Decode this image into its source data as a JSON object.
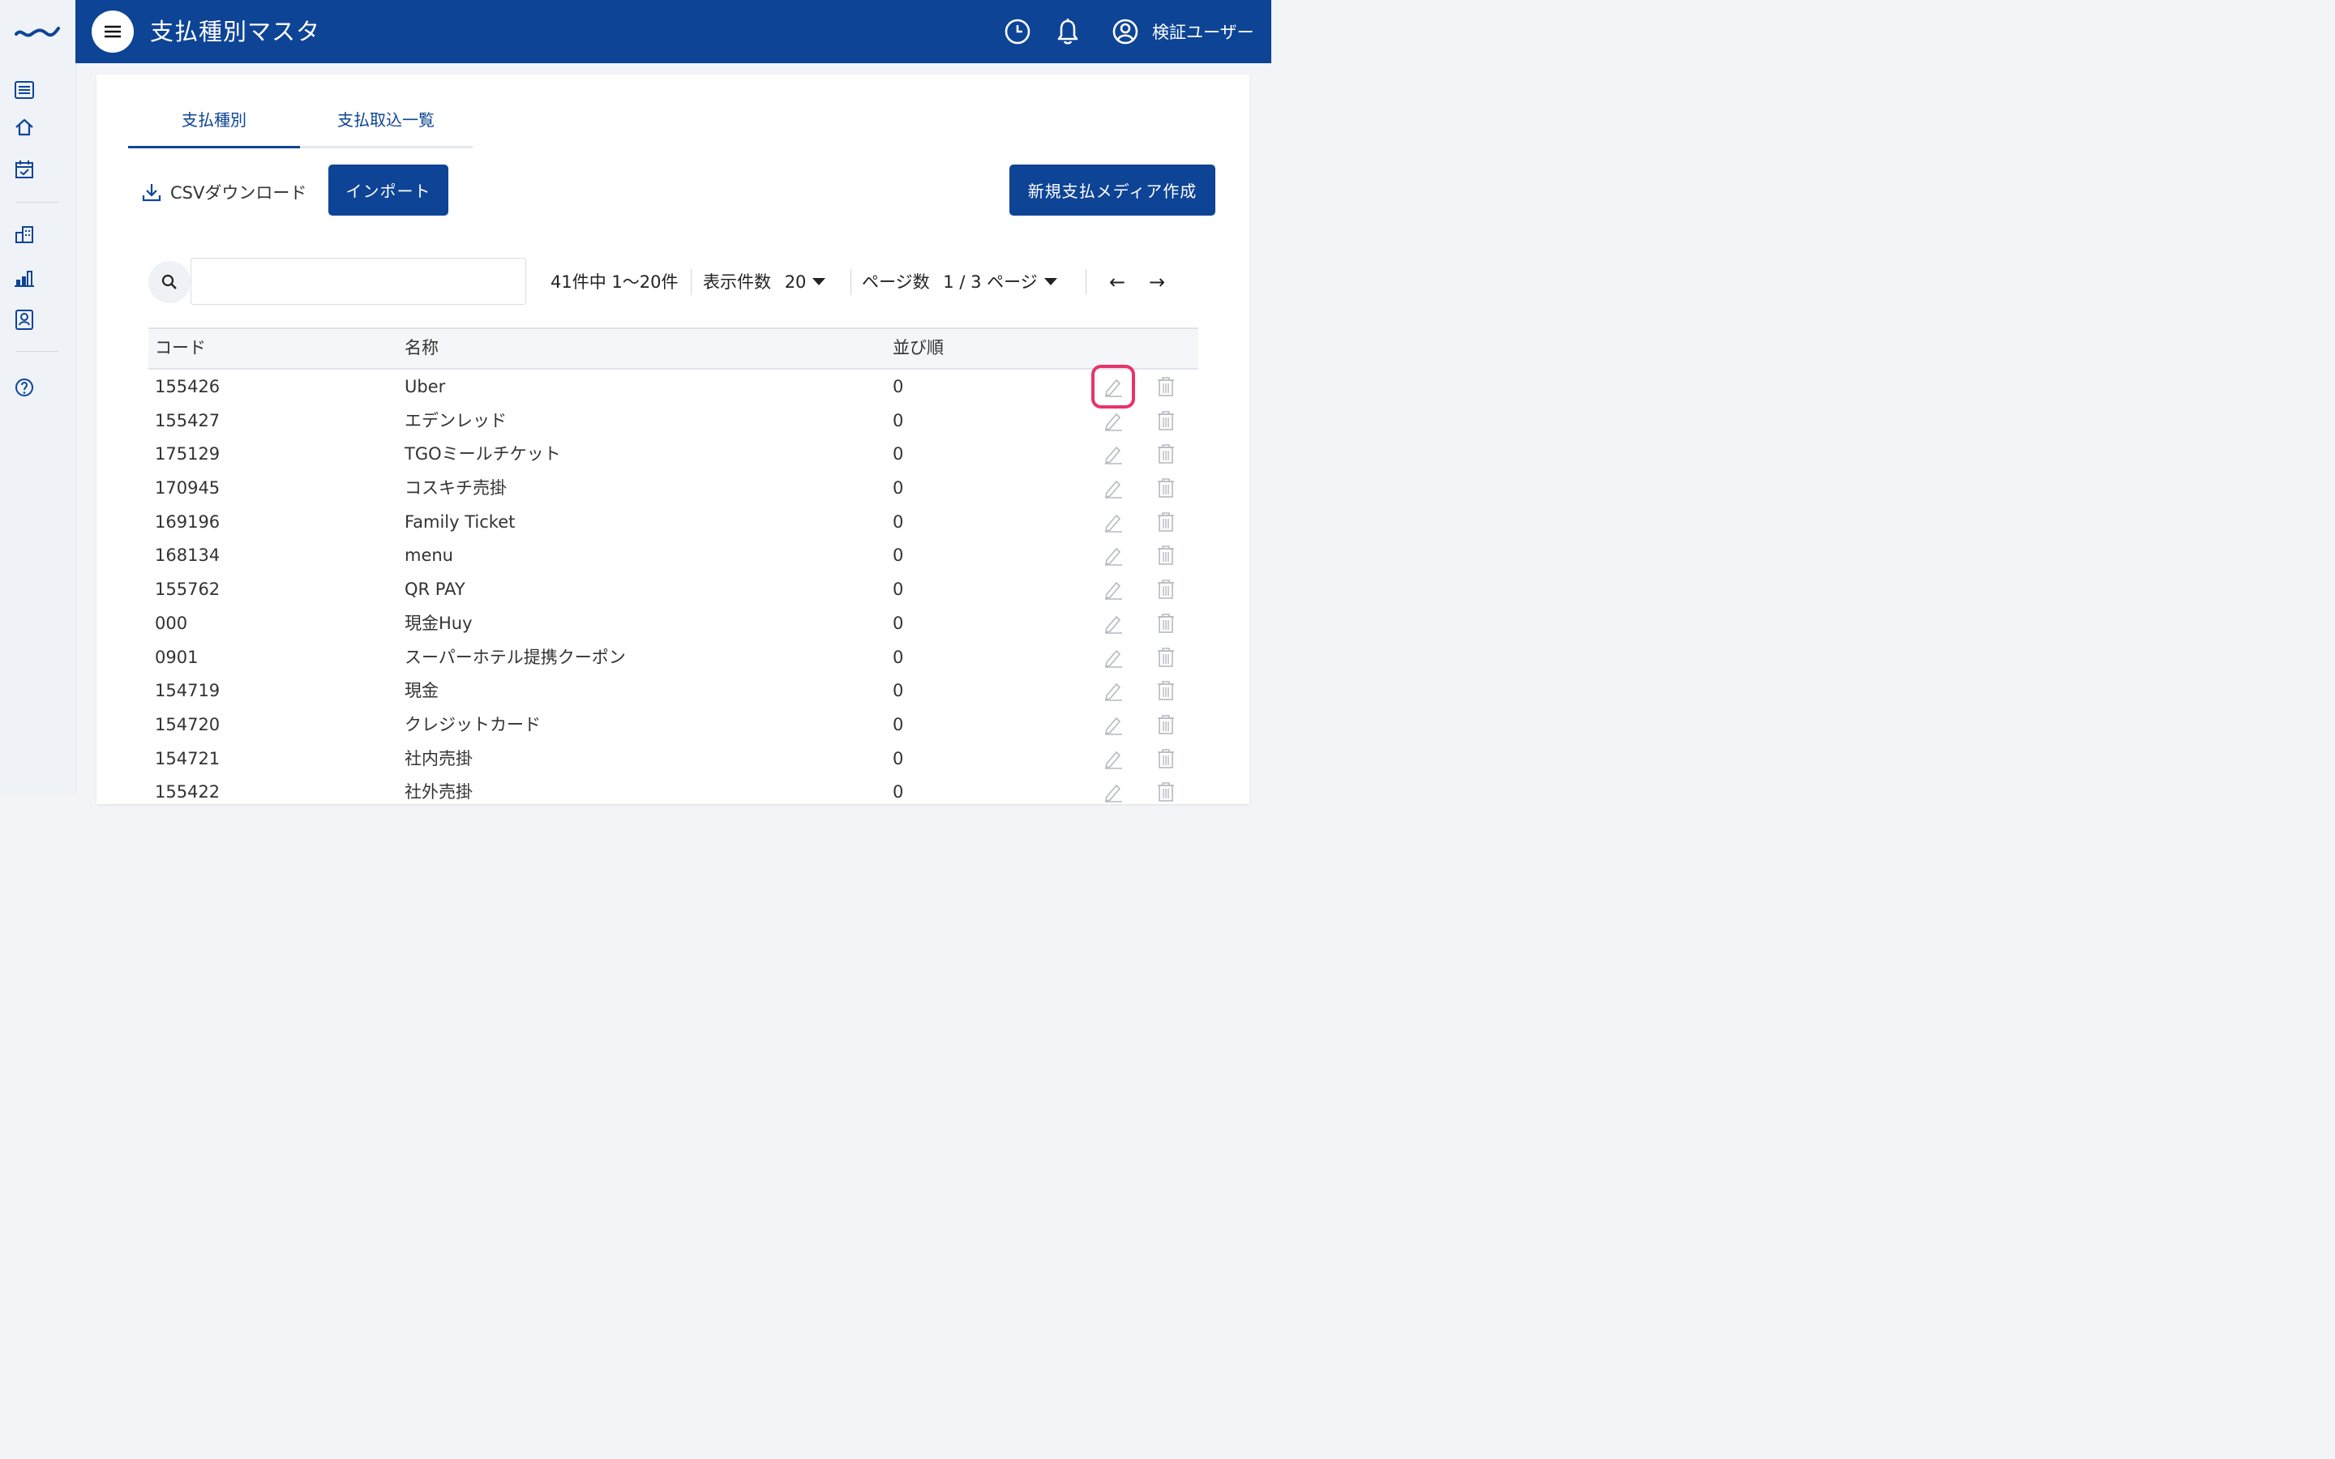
{
  "header": {
    "title": "支払種別マスタ",
    "user_name": "検証ユーザー"
  },
  "tabs": [
    {
      "label": "支払種別",
      "active": true
    },
    {
      "label": "支払取込一覧",
      "active": false
    }
  ],
  "toolbar": {
    "csv_download_label": "CSVダウンロード",
    "import_label": "インポート",
    "new_label": "新規支払メディア作成"
  },
  "search": {
    "placeholder": "",
    "value": ""
  },
  "pager": {
    "range_text": "41件中 1〜20件",
    "per_page_label": "表示件数",
    "per_page_value": "20",
    "page_label": "ページ数",
    "page_value": "1 / 3 ページ",
    "prev_symbol": "←",
    "next_symbol": "→"
  },
  "table": {
    "columns": [
      "コード",
      "名称",
      "並び順"
    ],
    "rows": [
      {
        "code": "155426",
        "name": "Uber",
        "order": "0"
      },
      {
        "code": "155427",
        "name": "エデンレッド",
        "order": "0"
      },
      {
        "code": "175129",
        "name": "TGOミールチケット",
        "order": "0"
      },
      {
        "code": "170945",
        "name": "コスキチ売掛",
        "order": "0"
      },
      {
        "code": "169196",
        "name": "Family Ticket",
        "order": "0"
      },
      {
        "code": "168134",
        "name": "menu",
        "order": "0"
      },
      {
        "code": "155762",
        "name": "QR PAY",
        "order": "0"
      },
      {
        "code": "000",
        "name": "現金Huy",
        "order": "0"
      },
      {
        "code": "0901",
        "name": "スーパーホテル提携クーポン",
        "order": "0"
      },
      {
        "code": "154719",
        "name": "現金",
        "order": "0"
      },
      {
        "code": "154720",
        "name": "クレジットカード",
        "order": "0"
      },
      {
        "code": "154721",
        "name": "社内売掛",
        "order": "0"
      },
      {
        "code": "155422",
        "name": "社外売掛",
        "order": "0"
      }
    ]
  },
  "colors": {
    "brand": "#0e4495",
    "highlight": "#e8336b",
    "action_icon": "#b5b9c0"
  },
  "icons": {
    "logo": "brand-wave-logo",
    "sidebar": [
      "list-icon",
      "home-icon",
      "calendar-check-icon",
      "building-icon",
      "bar-chart-icon",
      "contact-card-icon",
      "help-icon"
    ],
    "header": [
      "menu-icon",
      "clock-icon",
      "bell-icon",
      "user-circle-icon"
    ],
    "row_actions": [
      "edit-icon",
      "trash-icon"
    ]
  }
}
